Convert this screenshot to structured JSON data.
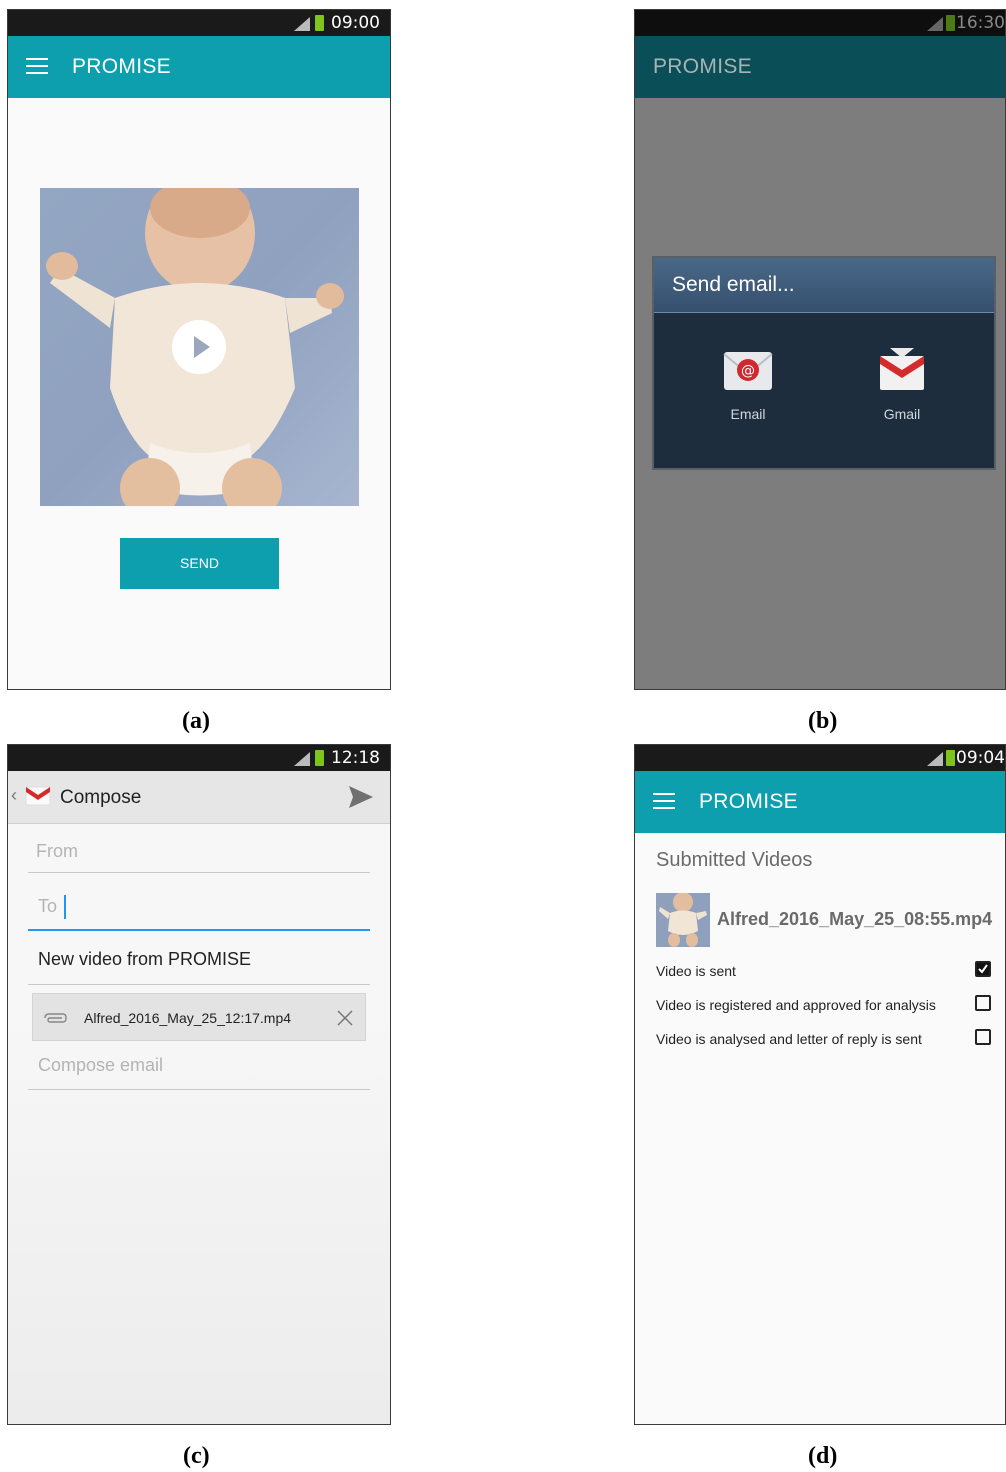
{
  "screen_a": {
    "status_time": "09:00",
    "app_title": "PROMISE",
    "send_label": "SEND",
    "caption": "(a)"
  },
  "screen_b": {
    "status_time": "16:30",
    "app_title": "PROMISE",
    "dialog_title": "Send email...",
    "options": [
      {
        "label": "Email",
        "icon": "email-app-icon"
      },
      {
        "label": "Gmail",
        "icon": "gmail-icon"
      }
    ],
    "caption": "(b)"
  },
  "screen_c": {
    "status_time": "12:18",
    "header_title": "Compose",
    "from_placeholder": "From",
    "to_placeholder": "To",
    "subject": "New video from PROMISE",
    "attachment": "Alfred_2016_May_25_12:17.mp4",
    "body_placeholder": "Compose email",
    "caption": "(c)"
  },
  "screen_d": {
    "status_time": "09:04",
    "app_title": "PROMISE",
    "section_title": "Submitted Videos",
    "video_file": "Alfred_2016_May_25_08:55.mp4",
    "statuses": [
      {
        "label": "Video is sent",
        "checked": true
      },
      {
        "label": "Video is registered and approved for analysis",
        "checked": false
      },
      {
        "label": "Video is analysed and letter of reply is sent",
        "checked": false
      }
    ],
    "caption": "(d)"
  },
  "colors": {
    "teal": "#0d9fae",
    "dark_teal": "#0a4e57",
    "dim_overlay": "#7d7d7d",
    "dialog_bg": "#1e2d3d",
    "dialog_header": "#3e5a78"
  }
}
